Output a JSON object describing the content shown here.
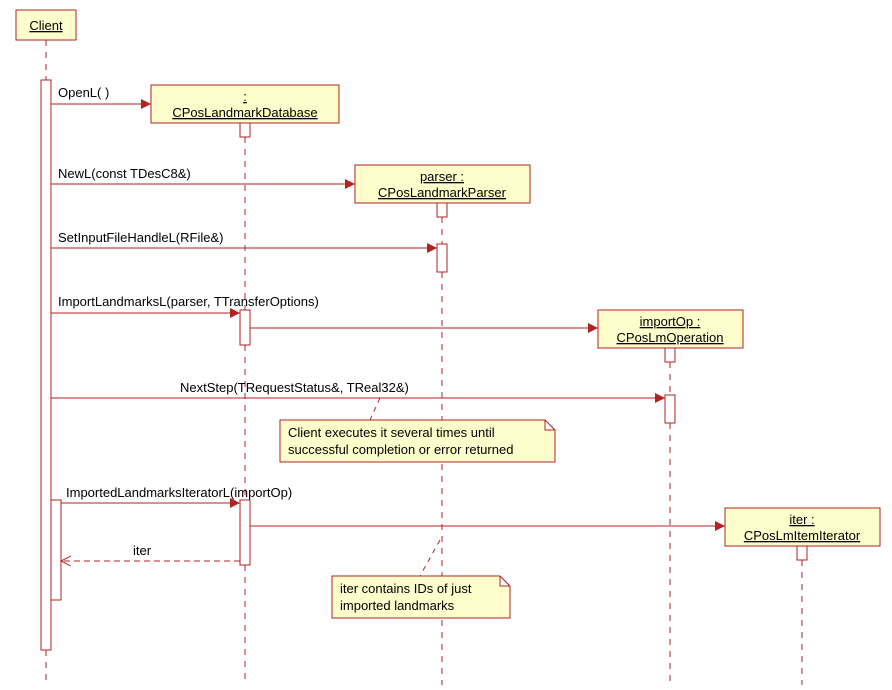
{
  "participants": {
    "client": {
      "name": "Client"
    },
    "db": {
      "name1": " : ",
      "name2": "CPosLandmarkDatabase"
    },
    "parser": {
      "name1": "parser : ",
      "name2": "CPosLandmarkParser"
    },
    "importOp": {
      "name1": "importOp : ",
      "name2": "CPosLmOperation"
    },
    "iter": {
      "name1": "iter : ",
      "name2": "CPosLmItemIterator"
    }
  },
  "messages": {
    "openL": "OpenL(  )",
    "newL": "NewL(const TDesC8&)",
    "setInput": "SetInputFileHandleL(RFile&)",
    "importLm": "ImportLandmarksL(parser, TTransferOptions)",
    "nextStep": "NextStep(TRequestStatus&, TReal32&)",
    "importedIter": "ImportedLandmarksIteratorL(importOp)",
    "iterReturn": "iter"
  },
  "notes": {
    "note1_l1": "Client executes it several times until",
    "note1_l2": "successful completion or error returned",
    "note2_l1": "iter contains IDs of just",
    "note2_l2": "imported landmarks"
  }
}
